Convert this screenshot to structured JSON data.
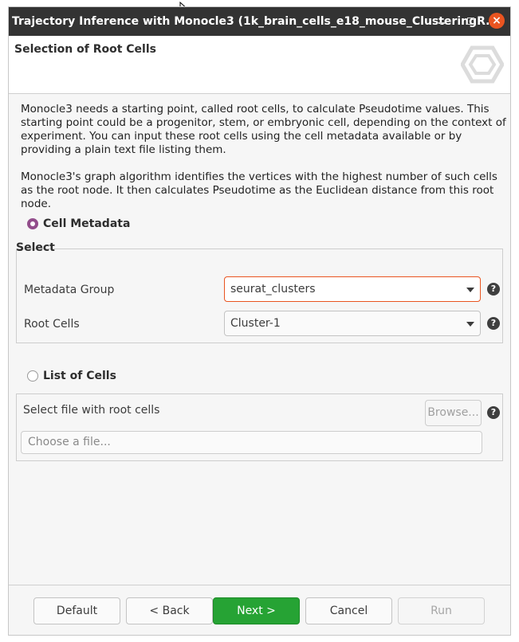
{
  "window": {
    "title": "Trajectory Inference with Monocle3  (1k_brain_cells_e18_mouse_ClusteringR...",
    "close_glyph": "×"
  },
  "header": {
    "title": "Selection of Root Cells",
    "logo_icon": "hexagon-logo-icon"
  },
  "description": {
    "paragraph1": "Monocle3 needs a starting point, called root cells, to calculate Pseudotime values. This starting point could be a progenitor, stem, or embryonic cell, depending on the context of experiment. You can input these root cells using the cell metadata available or by providing a plain text file listing them.",
    "paragraph2": "Monocle3's graph algorithm identifies the vertices with the highest number of such cells as the root node. It then calculates Pseudotime as the Euclidean distance from this root node."
  },
  "cell_metadata_option": {
    "label": "Cell Metadata",
    "selected": true
  },
  "select_group": {
    "title": "Select",
    "metadata_group": {
      "label": "Metadata Group",
      "value": "seurat_clusters"
    },
    "root_cells": {
      "label": "Root Cells",
      "value": "Cluster-1"
    },
    "help_glyph": "?"
  },
  "list_of_cells_option": {
    "label": "List of Cells",
    "selected": false
  },
  "file_section": {
    "label": "Select file with root cells",
    "browse_label": "Browse...",
    "placeholder": "Choose a file..."
  },
  "footer": {
    "default_label": "Default",
    "back_label": "< Back",
    "next_label": "Next >",
    "cancel_label": "Cancel",
    "run_label": "Run"
  },
  "colors": {
    "accent": "#e95420",
    "radio_selected": "#924d8b",
    "primary_button": "#26a334",
    "titlebar": "#333333"
  }
}
